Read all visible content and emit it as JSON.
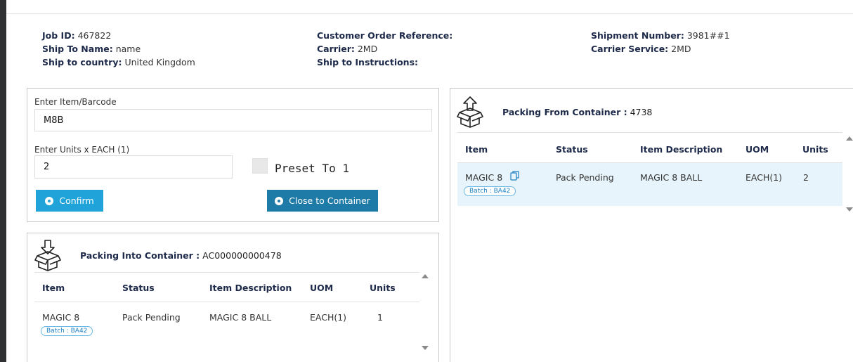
{
  "job": {
    "job_id_label": "Job ID:",
    "job_id": "467822",
    "ship_to_name_label": "Ship To Name:",
    "ship_to_name": "name",
    "ship_to_country_label": "Ship to country:",
    "ship_to_country": "United Kingdom",
    "customer_order_ref_label": "Customer Order Reference:",
    "customer_order_ref": "",
    "carrier_label": "Carrier:",
    "carrier": "2MD",
    "ship_to_instructions_label": "Ship to Instructions:",
    "ship_to_instructions": "",
    "shipment_number_label": "Shipment Number:",
    "shipment_number": "3981##1",
    "carrier_service_label": "Carrier Service:",
    "carrier_service": "2MD"
  },
  "entry": {
    "item_label": "Enter Item/Barcode",
    "item_value": "M8B",
    "units_label": "Enter Units x EACH (1)",
    "units_value": "2",
    "preset_label": "Preset To 1",
    "confirm_label": "Confirm",
    "close_label": "Close to Container"
  },
  "into_container": {
    "title": "Packing Into Container :",
    "container_id": "AC000000000478",
    "columns": [
      "Item",
      "Status",
      "Item Description",
      "UOM",
      "Units"
    ],
    "rows": [
      {
        "item": "MAGIC 8",
        "batch": "Batch : BA42",
        "status": "Pack Pending",
        "description": "MAGIC 8 BALL",
        "uom": "EACH(1)",
        "units": "1"
      }
    ]
  },
  "from_container": {
    "title": "Packing From Container :",
    "container_id": "4738",
    "columns": [
      "Item",
      "Status",
      "Item Description",
      "UOM",
      "Units"
    ],
    "rows": [
      {
        "item": "MAGIC 8",
        "batch": "Batch : BA42",
        "status": "Pack Pending",
        "description": "MAGIC 8 BALL",
        "uom": "EACH(1)",
        "units": "2"
      }
    ]
  },
  "icons": {
    "box_in": "box-arrow-in-icon",
    "box_out": "box-arrow-out-icon",
    "copy": "copy-icon"
  },
  "colors": {
    "accent": "#1fa3d8",
    "accent_dark": "#1e7aa6",
    "heading": "#1e2a4a",
    "row_highlight": "#e7f4fb"
  }
}
